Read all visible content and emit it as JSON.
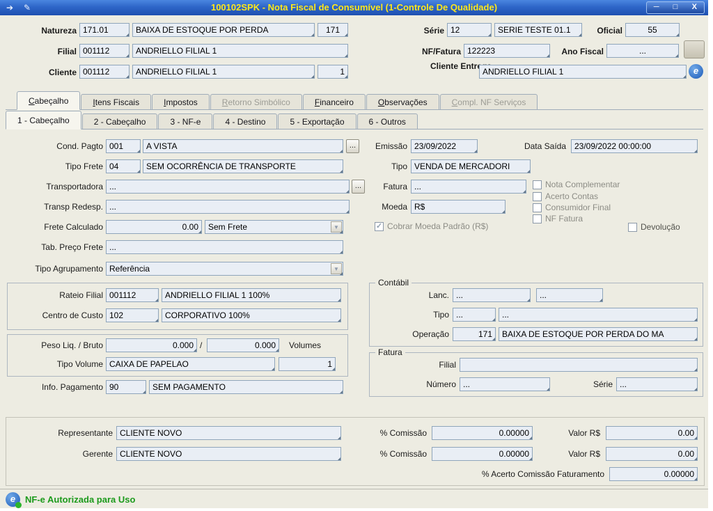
{
  "window": {
    "title": "100102SPK - Nota Fiscal de Consumível (1-Controle De Qualidade)",
    "minimize": "─",
    "maximize": "□",
    "close": "X"
  },
  "ui": {
    "ellipsis": "...",
    "combo_arrow": "▼",
    "check": "✓",
    "slash": "/",
    "titlebar_icon1": "➔",
    "titlebar_icon2": "✎",
    "brand_e": "e"
  },
  "header": {
    "natureza": {
      "label": "Natureza",
      "code": "171.01",
      "desc": "BAIXA DE ESTOQUE POR PERDA",
      "extra": "171"
    },
    "serie": {
      "label": "Série",
      "code": "12",
      "desc": "SERIE TESTE 01.1"
    },
    "oficial": {
      "label": "Oficial",
      "value": "55"
    },
    "filial": {
      "label": "Filial",
      "code": "001112",
      "desc": "ANDRIELLO FILIAL 1"
    },
    "nf_fatura": {
      "label": "NF/Fatura",
      "value": "122223"
    },
    "ano_fiscal": {
      "label": "Ano Fiscal",
      "value": "..."
    },
    "cliente": {
      "label": "Cliente",
      "code": "001112",
      "desc": "ANDRIELLO FILIAL 1",
      "loja": "1"
    },
    "cliente_entrega": {
      "label": "Cliente Entrega",
      "value": "ANDRIELLO FILIAL 1"
    }
  },
  "tabs": {
    "main": [
      {
        "label": "Cabeçalho"
      },
      {
        "label": "Itens Fiscais"
      },
      {
        "label": "Impostos"
      },
      {
        "label": "Retorno Simbólico"
      },
      {
        "label": "Financeiro"
      },
      {
        "label": "Observações"
      },
      {
        "label": "Compl. NF Serviços"
      }
    ],
    "sub": [
      {
        "label": "1 - Cabeçalho"
      },
      {
        "label": "2 - Cabeçalho"
      },
      {
        "label": "3 - NF-e"
      },
      {
        "label": "4 - Destino"
      },
      {
        "label": "5 - Exportação"
      },
      {
        "label": "6 - Outros"
      }
    ]
  },
  "form": {
    "cond_pagto_label": "Cond. Pagto",
    "cond_pagto_code": "001",
    "cond_pagto_desc": "A VISTA",
    "tipo_frete_label": "Tipo Frete",
    "tipo_frete_code": "04",
    "tipo_frete_desc": "SEM OCORRÊNCIA DE TRANSPORTE",
    "transportadora_label": "Transportadora",
    "transportadora_value": "...",
    "transp_redesp_label": "Transp Redesp.",
    "transp_redesp_value": "...",
    "frete_calc_label": "Frete Calculado",
    "frete_calc_value": "0.00",
    "frete_tipo_value": "Sem Frete",
    "tab_preco_label": "Tab. Preço Frete",
    "tab_preco_value": "...",
    "tipo_agrup_label": "Tipo Agrupamento",
    "tipo_agrup_value": "Referência",
    "rateio_label": "Rateio Filial",
    "rateio_code": "001112",
    "rateio_desc": "ANDRIELLO FILIAL 1 100%",
    "ccusto_label": "Centro de Custo",
    "ccusto_code": "102",
    "ccusto_desc": "CORPORATIVO 100%",
    "peso_label": "Peso Liq. / Bruto",
    "peso_liq": "0.000",
    "peso_bruto": "0.000",
    "volumes_label": "Volumes",
    "tipo_volume_label": "Tipo Volume",
    "tipo_volume_desc": "CAIXA DE PAPELAO",
    "tipo_volume_qtd": "1",
    "info_pag_label": "Info. Pagamento",
    "info_pag_code": "90",
    "info_pag_desc": "SEM PAGAMENTO",
    "emissao_label": "Emissão",
    "emissao_value": "23/09/2022",
    "data_saida_label": "Data Saída",
    "data_saida_value": "23/09/2022 00:00:00",
    "tipo_label": "Tipo",
    "tipo_value": "VENDA DE MERCADORI",
    "fatura_label": "Fatura",
    "fatura_value": "...",
    "moeda_label": "Moeda",
    "moeda_value": "R$",
    "cobrar_moeda_label": "Cobrar Moeda Padrão (R$)",
    "cobrar_moeda_checked": true,
    "chk_nota_complementar": "Nota Complementar",
    "chk_acerto_contas": "Acerto Contas",
    "chk_consumidor_final": "Consumidor Final",
    "chk_nf_fatura": "NF Fatura",
    "chk_devolucao": "Devolução",
    "contabil_legend": "Contábil",
    "lanc_label": "Lanc.",
    "lanc_value1": "...",
    "lanc_value2": "...",
    "ctipo_label": "Tipo",
    "ctipo_value1": "...",
    "ctipo_value2": "...",
    "operacao_label": "Operação",
    "operacao_code": "171",
    "operacao_desc": "BAIXA DE ESTOQUE POR PERDA DO MA",
    "fatura_legend": "Fatura",
    "ffilial_label": "Filial",
    "ffilial_value": "",
    "numero_label": "Número",
    "numero_value": "...",
    "fserie_label": "Série",
    "fserie_value": "...",
    "representante_label": "Representante",
    "representante_value": "CLIENTE NOVO",
    "gerente_label": "Gerente",
    "gerente_value": "CLIENTE NOVO",
    "pct_comissao_label": "% Comissão",
    "rep_pct": "0.00000",
    "ger_pct": "0.00000",
    "valor_label": "Valor R$",
    "rep_valor": "0.00",
    "ger_valor": "0.00",
    "acerto_label": "% Acerto Comissão Faturamento",
    "acerto_value": "0.00000"
  },
  "statusbar": {
    "message": "NF-e Autorizada para Uso"
  }
}
